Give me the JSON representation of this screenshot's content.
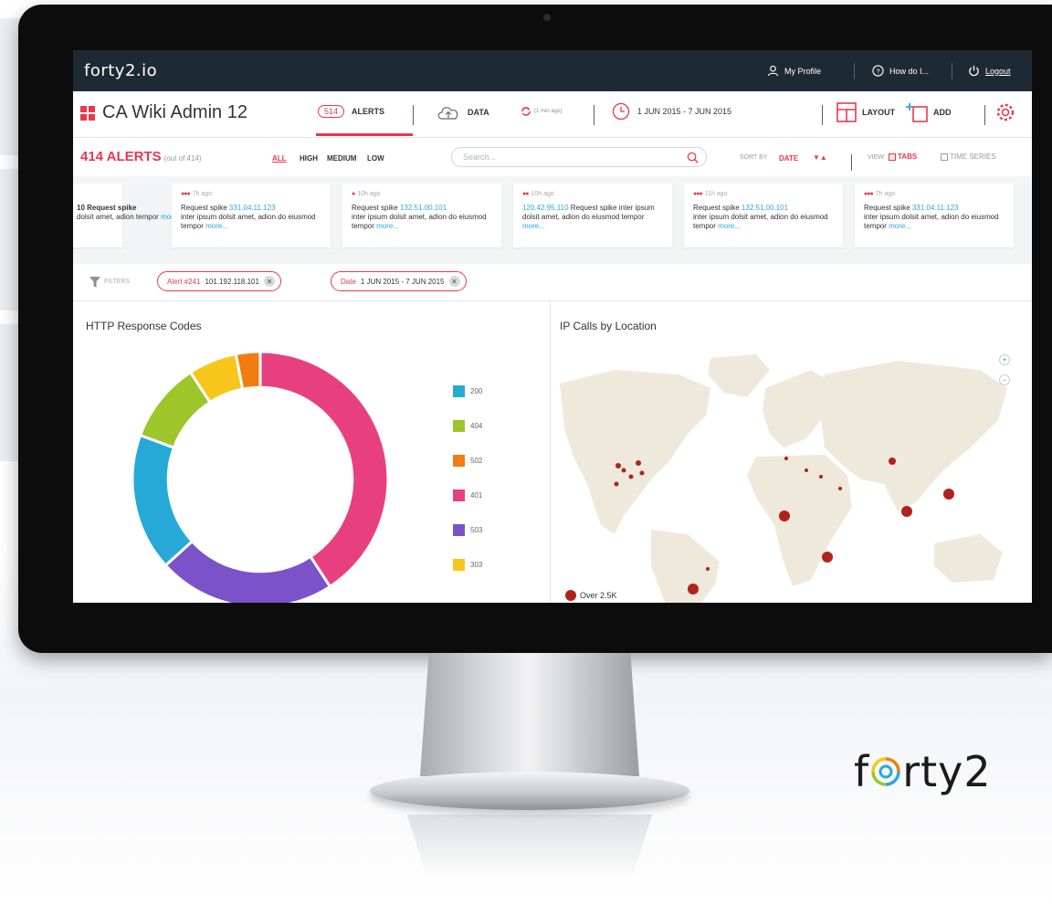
{
  "brand": "forty2.io",
  "topbar": {
    "profile": "My Profile",
    "howdo": "How do I...",
    "logout": "Logout"
  },
  "header": {
    "title": "CA Wiki Admin 12",
    "alerts_count": "514",
    "alerts_label": "ALERTS",
    "data_label": "DATA",
    "refresh": "(1 min ago)",
    "date_range": "1 JUN 2015 - 7 JUN 2015",
    "layout_label": "LAYOUT",
    "add_label": "ADD"
  },
  "filterbar": {
    "count": "414 ALERTS",
    "count_sub": "(out of 414)",
    "severities": [
      "ALL",
      "HIGH",
      "MEDIUM",
      "LOW"
    ],
    "search_placeholder": "Search...",
    "sort_by": "SORT BY",
    "sort_value": "DATE",
    "view": "VIEW:",
    "tabs_option": "TABS",
    "timeseries_option": "TIME SERIES"
  },
  "alert_cards": [
    {
      "time": "",
      "pre": "10 Request spike",
      "ip": "",
      "body": "dolsit amet, adion tempor",
      "more": "more..."
    },
    {
      "time": "7h ago",
      "pre": "Request spike ",
      "ip": "331.04.11.123",
      "body": "inter ipsum dolsit amet, adion do eiusmod tempor ",
      "more": "more..."
    },
    {
      "time": "10h ago",
      "pre": "Request spike ",
      "ip": "132.51.00.101",
      "body": "inter ipsum dolsit amet, adion do eiusmod tempor ",
      "more": "more..."
    },
    {
      "time": "10h ago",
      "pre": "",
      "ip": "120.42.95.110",
      "body": " Request spike inter ipsum dolsit amet, adion do eiusmod tempor ",
      "more": "more..."
    },
    {
      "time": "11h ago",
      "pre": "Request spike ",
      "ip": "132.51.00.101",
      "body": "inter ipsum dolsit amet, adion do eiusmod tempor ",
      "more": "more..."
    },
    {
      "time": "7h ago",
      "pre": "Request spike ",
      "ip": "331.04.11.123",
      "body": "inter ipsum dolsit amet, adion do eiusmod tempor ",
      "more": "more..."
    }
  ],
  "filters": {
    "label": "FILTERS",
    "chips": [
      {
        "key": "Alert #241",
        "value": "101.192.118.101"
      },
      {
        "key": "Date",
        "value": "1 JUN 2015 - 7 JUN 2015"
      }
    ]
  },
  "http_panel": {
    "title": "HTTP Response Codes"
  },
  "map_panel": {
    "title": "IP Calls by Location",
    "zoom_in": "+",
    "zoom_out": "-",
    "legend_label": "Over 2.5K"
  },
  "colors": {
    "accent": "#e8384f",
    "link": "#29a8e0",
    "topbar": "#1e2a33"
  },
  "chart_data": {
    "type": "pie",
    "title": "HTTP Response Codes",
    "categories": [
      "200",
      "404",
      "502",
      "401",
      "503",
      "303"
    ],
    "values": [
      17,
      10,
      3,
      40,
      22,
      6
    ],
    "colors": [
      "#26a9d6",
      "#9cc62a",
      "#f27c0f",
      "#e8407e",
      "#7b52c9",
      "#f7c61b"
    ],
    "hole": 0.72,
    "legend": "right"
  },
  "logo_text": "forty2"
}
